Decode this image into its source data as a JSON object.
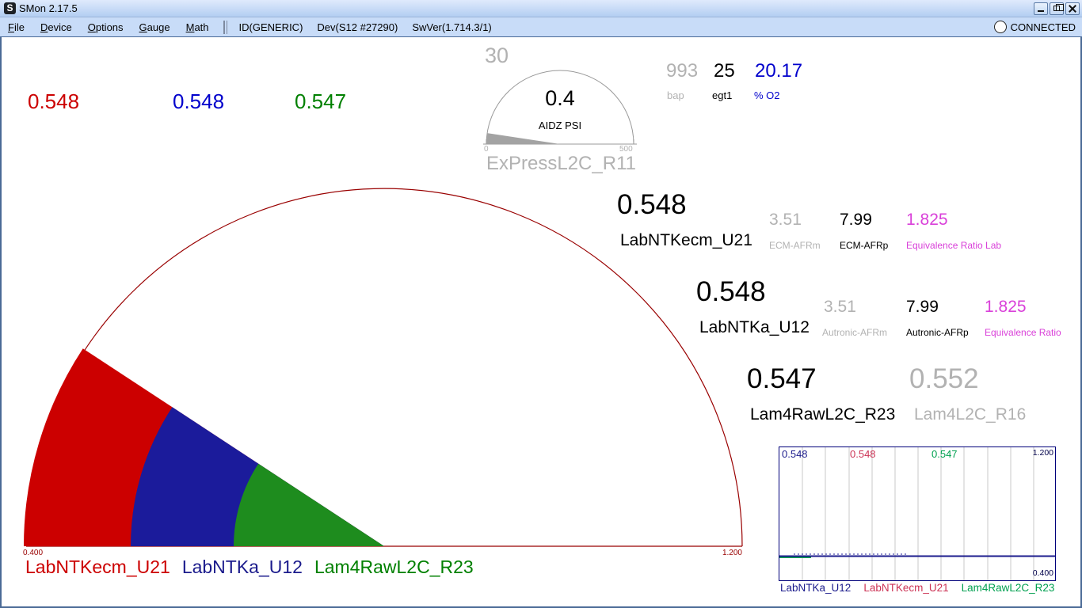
{
  "colors": {
    "red": "#cc0000",
    "blue": "#0000cc",
    "green": "#008000",
    "grey": "#b2b2b2",
    "magenta": "#d940d9",
    "navy": "#1b1b8c",
    "crimson": "#cc3355",
    "chart_green": "#00a050",
    "gauge_arc": "#990000",
    "wedge_red": "#cc0000",
    "wedge_blue": "#1b1b9b",
    "wedge_green": "#1e8c1e",
    "aux_grey": "#a3a3a3",
    "aux_line": "#999999"
  },
  "window": {
    "icon_glyph": "S",
    "title": "SMon 2.17.5",
    "connection": "CONNECTED"
  },
  "menu": {
    "items": [
      {
        "label": "File"
      },
      {
        "label": "Device"
      },
      {
        "label": "Options"
      },
      {
        "label": "Gauge"
      },
      {
        "label": "Math"
      }
    ],
    "status": {
      "id": "ID(GENERIC)",
      "dev": "Dev(S12 #27290)",
      "swver": "SwVer(1.714.3/1)"
    }
  },
  "top_readings": [
    {
      "value": "0.548"
    },
    {
      "value": "0.548"
    },
    {
      "value": "0.547"
    }
  ],
  "aux_gauge": {
    "peak": "30",
    "value": "0.4",
    "label": "AIDZ PSI",
    "min": "0",
    "max": "500",
    "channel": "ExPressL2C_R11"
  },
  "side_readings": [
    {
      "value": "993",
      "label": "bap"
    },
    {
      "value": "25",
      "label": "egt1"
    },
    {
      "value": "20.17",
      "label": "% O2"
    }
  ],
  "blocks": [
    {
      "value": "0.548",
      "name": "LabNTKecm_U21",
      "subs": [
        {
          "value": "3.51",
          "label": "ECM-AFRm"
        },
        {
          "value": "7.99",
          "label": "ECM-AFRp"
        },
        {
          "value": "1.825",
          "label": "Equivalence Ratio Lab"
        }
      ]
    },
    {
      "value": "0.548",
      "name": "LabNTKa_U12",
      "subs": [
        {
          "value": "3.51",
          "label": "Autronic-AFRm"
        },
        {
          "value": "7.99",
          "label": "Autronic-AFRp"
        },
        {
          "value": "1.825",
          "label": "Equivalence Ratio"
        }
      ]
    },
    {
      "value": "0.547",
      "name": "Lam4RawL2C_R23",
      "alt": {
        "value": "0.552",
        "label": "Lam4L2C_R16"
      }
    }
  ],
  "main_gauge": {
    "min": "0.400",
    "max": "1.200",
    "legend": [
      {
        "label": "LabNTKecm_U21"
      },
      {
        "label": "LabNTKa_U12"
      },
      {
        "label": "Lam4RawL2C_R23"
      }
    ]
  },
  "mini_chart": {
    "ymax": "1.200",
    "ymin": "0.400",
    "values": [
      {
        "v": "0.548"
      },
      {
        "v": "0.548"
      },
      {
        "v": "0.547"
      }
    ],
    "legend": [
      {
        "label": "LabNTKa_U12"
      },
      {
        "label": "LabNTKecm_U21"
      },
      {
        "label": "Lam4RawL2C_R23"
      }
    ]
  },
  "chart_data": {
    "type": "line",
    "title": "",
    "xlabel": "",
    "ylabel": "",
    "ylim": [
      0.4,
      1.2
    ],
    "grid": "vertical",
    "legend_position": "bottom",
    "series": [
      {
        "name": "LabNTKa_U12",
        "color": "#1b1b8c",
        "values": [
          0.548,
          0.548,
          0.548,
          0.548,
          0.548
        ]
      },
      {
        "name": "LabNTKecm_U21",
        "color": "#cc3355",
        "values": [
          0.548,
          0.548,
          0.548,
          0.548,
          0.548
        ]
      },
      {
        "name": "Lam4RawL2C_R23",
        "color": "#00a050",
        "values": [
          0.547,
          0.547,
          0.547,
          0.547,
          0.547
        ]
      }
    ]
  }
}
